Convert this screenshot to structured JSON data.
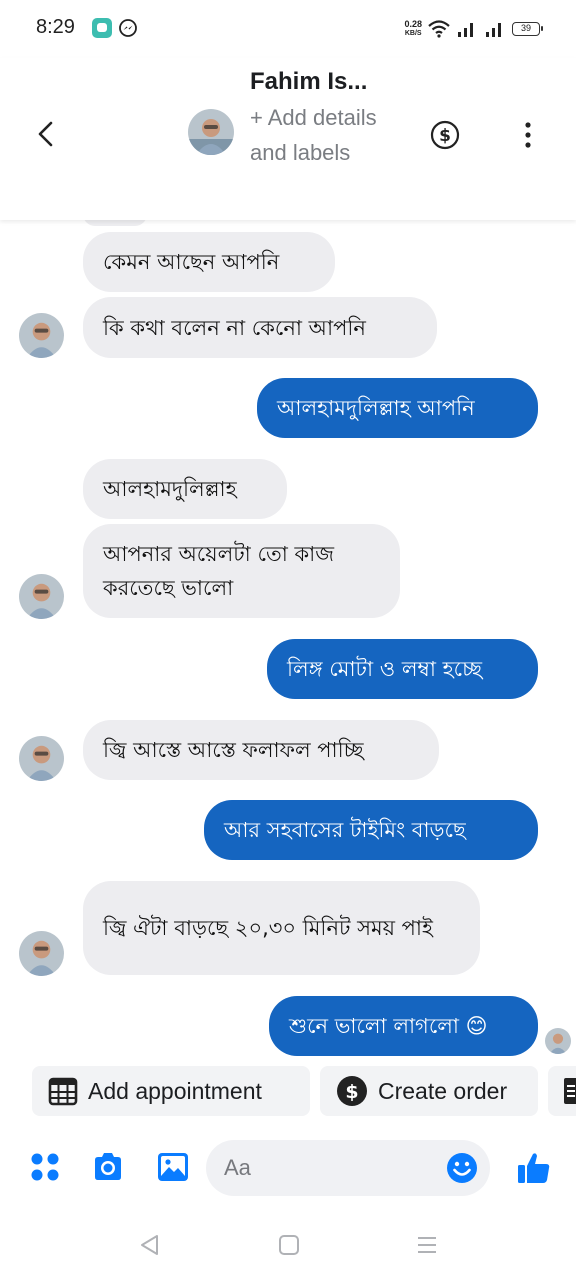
{
  "status_bar": {
    "time": "8:29",
    "net_speed_value": "0.28",
    "net_speed_unit": "KB/S",
    "battery": "39"
  },
  "header": {
    "contact_name": "Fahim Is...",
    "subtitle": "+ Add details and labels"
  },
  "messages": [
    {
      "dir": "in",
      "text": "কেমন আছেন আপনি"
    },
    {
      "dir": "in",
      "text": "কি কথা বলেন না কেনো আপনি"
    },
    {
      "dir": "out",
      "text": "আলহামদুলিল্লাহ আপনি"
    },
    {
      "dir": "in",
      "text": "আলহামদুলিল্লাহ"
    },
    {
      "dir": "in",
      "text": "আপনার অয়েলটা তো কাজ করতেছে ভালো"
    },
    {
      "dir": "out",
      "text": "লিঙ্গ মোটা ও লম্বা হচ্ছে"
    },
    {
      "dir": "in",
      "text": "জ্বি আস্তে আস্তে ফলাফল পাচ্ছি"
    },
    {
      "dir": "out",
      "text": "আর সহবাসের টাইমিং বাড়ছে"
    },
    {
      "dir": "in",
      "text": "জ্বি ঐটা বাড়ছে ২০,৩০ মিনিট সময় পাই"
    },
    {
      "dir": "out",
      "text": "শুনে ভালো লাগলো 😊"
    }
  ],
  "quick_actions": {
    "add_appointment": "Add appointment",
    "create_order": "Create order"
  },
  "composer": {
    "placeholder": "Aa"
  },
  "colors": {
    "outgoing_bubble": "#1565c0",
    "incoming_bubble": "#ededf0",
    "accent": "#0a7cff"
  },
  "icons": [
    "back-arrow-icon",
    "dollar-icon",
    "more-vertical-icon",
    "calendar-icon",
    "dollar-circle-icon",
    "menu-dots-icon",
    "camera-icon",
    "gallery-icon",
    "emoji-icon",
    "thumbs-up-icon"
  ]
}
